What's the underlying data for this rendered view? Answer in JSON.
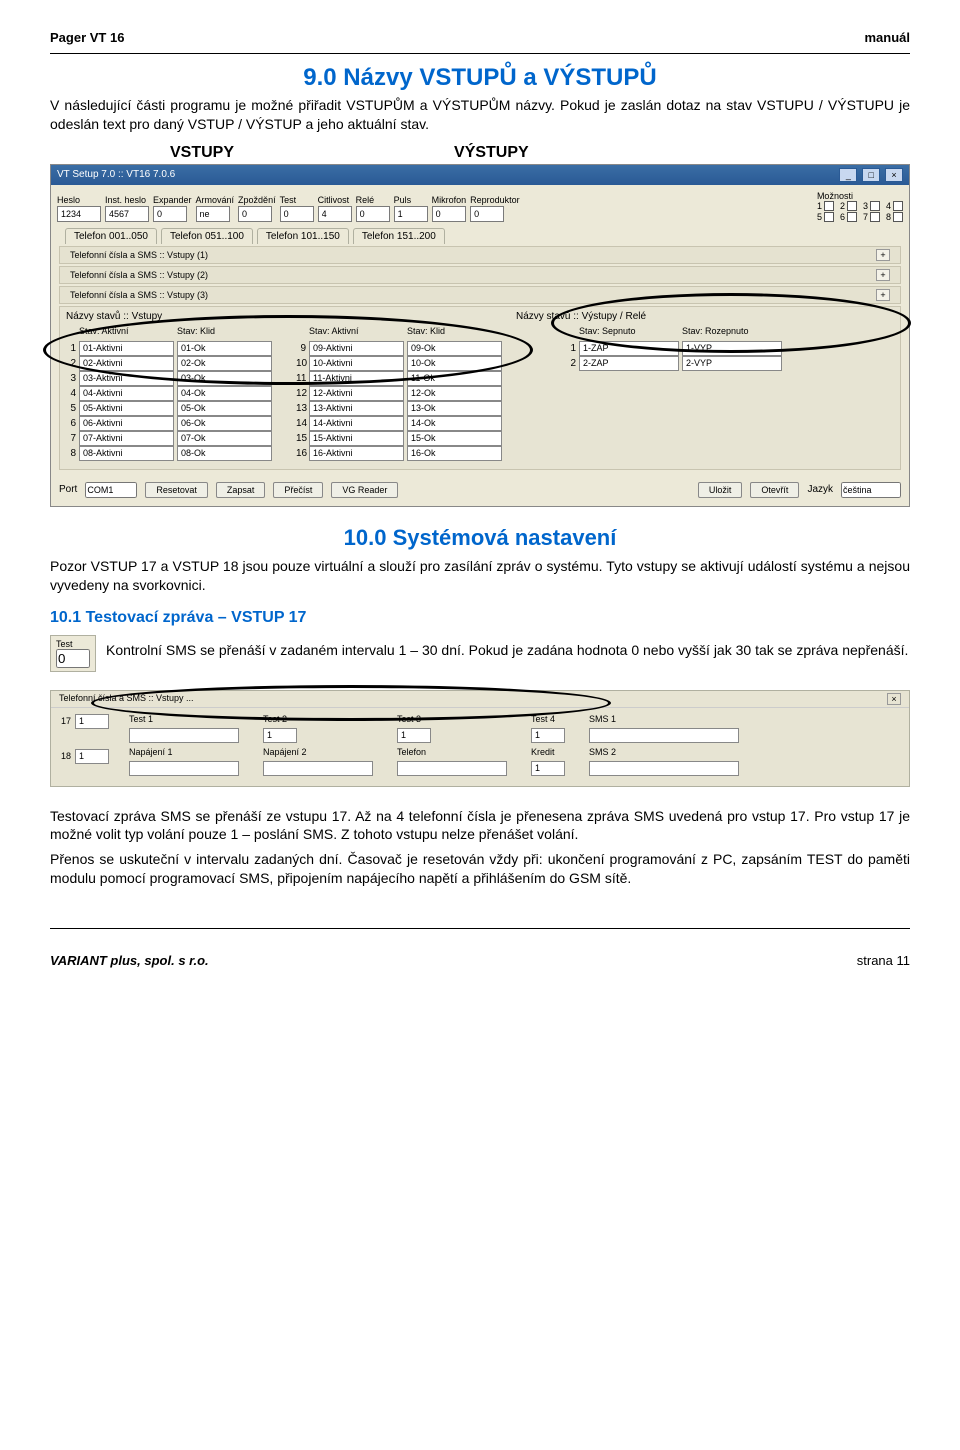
{
  "doc": {
    "header_left": "Pager VT 16",
    "header_right": "manuál",
    "h1": "9.0 Názvy VSTUPŮ a VÝSTUPŮ",
    "p1": "V následující části programu je možné přiřadit VSTUPŮM a VÝSTUPŮM názvy. Pokud je zaslán dotaz na stav VSTUPU / VÝSTUPU je odeslán text pro daný VSTUP / VÝSTUP a jeho aktuální stav.",
    "lbl_vstupy": "VSTUPY",
    "lbl_vystupy": "VÝSTUPY",
    "h2": "10.0 Systémová nastavení",
    "p2": "Pozor VSTUP 17 a VSTUP 18 jsou pouze virtuální a slouží pro zasílání zpráv o systému. Tyto vstupy se aktivují událostí systému a nejsou vyvedeny na svorkovnici.",
    "h3": "10.1 Testovací zpráva – VSTUP 17",
    "p3": "Kontrolní SMS se přenáší v zadaném intervalu 1 – 30 dní. Pokud je zadána hodnota 0 nebo vyšší jak 30 tak se zpráva nepřenáší.",
    "p4": "Testovací zpráva SMS se přenáší ze vstupu 17. Až na 4 telefonní čísla je přenesena zpráva SMS uvedená pro vstup 17. Pro vstup 17 je možné volit typ volání pouze 1 – poslání SMS. Z tohoto vstupu nelze přenášet volání.",
    "p5": "Přenos se uskuteční v intervalu zadaných dní. Časovač je resetován vždy při: ukončení programování z PC, zapsáním TEST do paměti modulu pomocí programovací SMS, připojením napájecího napětí a přihlášením do GSM sítě.",
    "footer_left": "VARIANT plus, spol. s r.o.",
    "footer_right": "strana 11"
  },
  "app": {
    "title": "VT Setup 7.0 :: VT16 7.0.6",
    "toolbar": {
      "heslo": {
        "label": "Heslo",
        "value": "1234"
      },
      "instheslo": {
        "label": "Inst. heslo",
        "value": "4567"
      },
      "expander": {
        "label": "Expander",
        "value": "0"
      },
      "armovani": {
        "label": "Armování",
        "value": "ne"
      },
      "zpozdeni": {
        "label": "Zpoždění",
        "value": "0"
      },
      "test": {
        "label": "Test",
        "value": "0"
      },
      "citlivost": {
        "label": "Citlivost",
        "value": "4"
      },
      "rele": {
        "label": "Relé",
        "value": "0"
      },
      "puls": {
        "label": "Puls",
        "value": "1"
      },
      "mikrofon": {
        "label": "Mikrofon",
        "value": "0"
      },
      "reproduktor": {
        "label": "Reproduktor",
        "value": "0"
      },
      "moznosti_label": "Možnosti",
      "moznosti": [
        "1",
        "2",
        "3",
        "4",
        "5",
        "6",
        "7",
        "8"
      ]
    },
    "tabs": [
      "Telefon 001..050",
      "Telefon 051..100",
      "Telefon 101..150",
      "Telefon 151..200"
    ],
    "strips": [
      "Telefonní čísla a SMS :: Vstupy (1)",
      "Telefonní čísla a SMS :: Vstupy (2)",
      "Telefonní čísla a SMS :: Vstupy (3)"
    ],
    "nazvy": {
      "left_title": "Názvy stavů :: Vstupy",
      "right_title": "Názvy stavů :: Výstupy / Relé",
      "hdr_aktivni": "Stav: Aktivní",
      "hdr_klid": "Stav: Klid",
      "hdr_sepnuto": "Stav: Sepnuto",
      "hdr_rozepnuto": "Stav: Rozepnuto",
      "left": [
        {
          "n": "1",
          "a": "01-Aktivni",
          "k": "01-Ok"
        },
        {
          "n": "2",
          "a": "02-Aktivni",
          "k": "02-Ok"
        },
        {
          "n": "3",
          "a": "03-Aktivni",
          "k": "03-Ok"
        },
        {
          "n": "4",
          "a": "04-Aktivni",
          "k": "04-Ok"
        },
        {
          "n": "5",
          "a": "05-Aktivni",
          "k": "05-Ok"
        },
        {
          "n": "6",
          "a": "06-Aktivni",
          "k": "06-Ok"
        },
        {
          "n": "7",
          "a": "07-Aktivni",
          "k": "07-Ok"
        },
        {
          "n": "8",
          "a": "08-Aktivni",
          "k": "08-Ok"
        }
      ],
      "mid": [
        {
          "n": "9",
          "a": "09-Aktivni",
          "k": "09-Ok"
        },
        {
          "n": "10",
          "a": "10-Aktivni",
          "k": "10-Ok"
        },
        {
          "n": "11",
          "a": "11-Aktivni",
          "k": "11-Ok"
        },
        {
          "n": "12",
          "a": "12-Aktivni",
          "k": "12-Ok"
        },
        {
          "n": "13",
          "a": "13-Aktivni",
          "k": "13-Ok"
        },
        {
          "n": "14",
          "a": "14-Aktivni",
          "k": "14-Ok"
        },
        {
          "n": "15",
          "a": "15-Aktivni",
          "k": "15-Ok"
        },
        {
          "n": "16",
          "a": "16-Aktivni",
          "k": "16-Ok"
        }
      ],
      "right": [
        {
          "n": "1",
          "s": "1-ZAP",
          "r": "1-VYP"
        },
        {
          "n": "2",
          "s": "2-ZAP",
          "r": "2-VYP"
        }
      ]
    },
    "bottom": {
      "port_label": "Port",
      "port_value": "COM1",
      "reset": "Resetovat",
      "zapsat": "Zapsat",
      "precist": "Přečíst",
      "vgreader": "VG Reader",
      "ulozit": "Uložit",
      "otevrit": "Otevřít",
      "jazyk_label": "Jazyk",
      "jazyk_value": "čeština"
    }
  },
  "test_mini": {
    "label": "Test",
    "value": "0"
  },
  "panel2": {
    "title": "Telefonní čísla a SMS :: Vstupy ...",
    "cols": {
      "test1": "Test 1",
      "test2": "Test 2",
      "test3": "Test 3",
      "test4": "Test 4",
      "sms1": "SMS 1",
      "napajeni1": "Napájení 1",
      "napajeni2": "Napájení 2",
      "telefon": "Telefon",
      "kredit": "Kredit",
      "sms2": "SMS 2"
    },
    "vals": {
      "r17": "17",
      "r18": "18",
      "one": "1"
    }
  }
}
